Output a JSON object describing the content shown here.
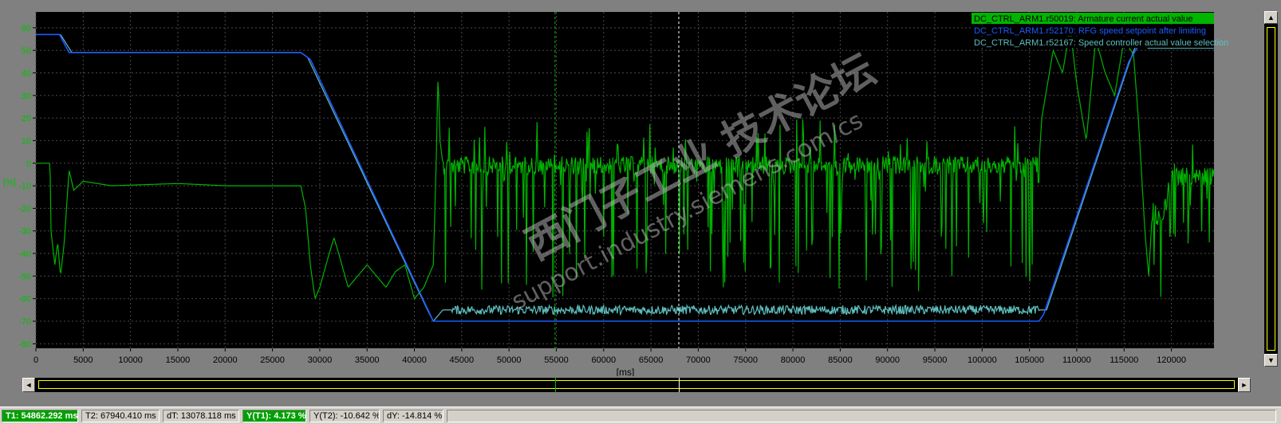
{
  "colors": {
    "plot_bg": "#000000",
    "frame_bg": "#808080",
    "grid": "#4a4a4a",
    "axis_text": "#00c000",
    "x_text": "#000000",
    "series_current": "#00b400",
    "series_setpoint": "#1e5aff",
    "series_actual": "#5fbfbf",
    "cursor": "#ffffff",
    "cursor1": "#00c000",
    "watermark": "#b0b0b0"
  },
  "watermark": {
    "line1": "西门子工业 技术论坛",
    "line2": "support.industry.siemens.com/cs"
  },
  "chart_data": {
    "type": "line",
    "xlabel": "[ms]",
    "ylabel": "[%]",
    "xlim": [
      0,
      124500
    ],
    "ylim": [
      -82,
      67
    ],
    "x_ticks": [
      0,
      5000,
      10000,
      15000,
      20000,
      25000,
      30000,
      35000,
      40000,
      45000,
      50000,
      55000,
      60000,
      65000,
      70000,
      75000,
      80000,
      85000,
      90000,
      95000,
      100000,
      105000,
      110000,
      115000,
      120000
    ],
    "x_tick_labels": [
      "0",
      "5000",
      "10000",
      "15000",
      "20000",
      "25000",
      "30000",
      "35000",
      "40000",
      "45000",
      "50000",
      "55000",
      "60000",
      "65000",
      "70000",
      "75000",
      "80000",
      "85000",
      "90000",
      "95000",
      "100000",
      "105000",
      "110000",
      "115000",
      "120000"
    ],
    "y_ticks": [
      60,
      50,
      40,
      30,
      20,
      10,
      0,
      -10,
      -20,
      -30,
      -40,
      -50,
      -60,
      -70,
      -80
    ],
    "y_tick_labels": [
      "60",
      "50",
      "40",
      "30",
      "20",
      "10",
      "0",
      "-10",
      "-20",
      "-30",
      "-40",
      "-50",
      "-60",
      "-70",
      "-80"
    ],
    "grid": true,
    "legend_position": "top-right",
    "cursors": {
      "t1": 54862.292,
      "t2": 67940.41
    },
    "series": [
      {
        "name": "DC_CTRL_ARM1.r50019: Armature current actual value",
        "color": "#00b400",
        "noise_segments": [
          [
            43000,
            106000,
            60
          ],
          [
            118000,
            124500,
            35
          ]
        ],
        "points": [
          [
            0,
            0
          ],
          [
            1500,
            0
          ],
          [
            1600,
            -30
          ],
          [
            2000,
            -45
          ],
          [
            2300,
            -35
          ],
          [
            2600,
            -50
          ],
          [
            3000,
            -35
          ],
          [
            3500,
            -3
          ],
          [
            4000,
            -12
          ],
          [
            5000,
            -8
          ],
          [
            8000,
            -10
          ],
          [
            15000,
            -9
          ],
          [
            20000,
            -10
          ],
          [
            25000,
            -10
          ],
          [
            28000,
            -10
          ],
          [
            28500,
            -20
          ],
          [
            29000,
            -45
          ],
          [
            29500,
            -60
          ],
          [
            30000,
            -55
          ],
          [
            31000,
            -40
          ],
          [
            31500,
            -33
          ],
          [
            32000,
            -40
          ],
          [
            33000,
            -55
          ],
          [
            34000,
            -50
          ],
          [
            35000,
            -45
          ],
          [
            36000,
            -50
          ],
          [
            37000,
            -55
          ],
          [
            38000,
            -48
          ],
          [
            39000,
            -45
          ],
          [
            40000,
            -60
          ],
          [
            41000,
            -55
          ],
          [
            42000,
            -45
          ],
          [
            42300,
            0
          ],
          [
            42500,
            40
          ],
          [
            42700,
            10
          ],
          [
            43000,
            0
          ],
          [
            106000,
            0
          ],
          [
            106300,
            20
          ],
          [
            107500,
            50
          ],
          [
            108500,
            40
          ],
          [
            109300,
            60
          ],
          [
            110000,
            35
          ],
          [
            111000,
            10
          ],
          [
            112000,
            55
          ],
          [
            113000,
            40
          ],
          [
            114000,
            30
          ],
          [
            115000,
            55
          ],
          [
            116000,
            48
          ],
          [
            116500,
            20
          ],
          [
            117200,
            -30
          ],
          [
            117600,
            -50
          ],
          [
            118000,
            -20
          ],
          [
            119000,
            -25
          ],
          [
            120000,
            -5
          ],
          [
            124500,
            -5
          ]
        ]
      },
      {
        "name": "DC_CTRL_ARM1.r52170: RFG speed setpoint after limiting",
        "color": "#1e5aff",
        "points": [
          [
            0,
            57
          ],
          [
            2500,
            57
          ],
          [
            3500,
            49
          ],
          [
            4000,
            49
          ],
          [
            28000,
            49
          ],
          [
            29000,
            46
          ],
          [
            42000,
            -70
          ],
          [
            42500,
            -70
          ],
          [
            106000,
            -70
          ],
          [
            106500,
            -67
          ],
          [
            115500,
            45
          ],
          [
            116500,
            52
          ],
          [
            117000,
            52
          ]
        ]
      },
      {
        "name": "DC_CTRL_ARM1.r52167: Speed controller actual value selection",
        "color": "#5fbfbf",
        "noise_segments": [
          [
            44000,
            106000,
            2
          ]
        ],
        "points": [
          [
            0,
            57
          ],
          [
            2600,
            57
          ],
          [
            3800,
            49
          ],
          [
            28000,
            49
          ],
          [
            28700,
            47
          ],
          [
            41500,
            -66
          ],
          [
            42000,
            -70
          ],
          [
            43000,
            -65
          ],
          [
            106000,
            -65
          ],
          [
            106800,
            -65
          ],
          [
            115500,
            44
          ],
          [
            116500,
            55
          ],
          [
            117500,
            51
          ],
          [
            124500,
            51
          ]
        ]
      }
    ]
  },
  "status": {
    "t1": "T1: 54862.292 ms",
    "t2": "T2: 67940.410 ms",
    "dt": "dT: 13078.118 ms",
    "y_t1": "Y(T1):  4.173 %",
    "y_t2": "Y(T2): -10.642 %",
    "dy": "dY: -14.814 %"
  },
  "scroll": {
    "left_arrow": "◄",
    "right_arrow": "►",
    "up_arrow": "▲",
    "down_arrow": "▼"
  }
}
